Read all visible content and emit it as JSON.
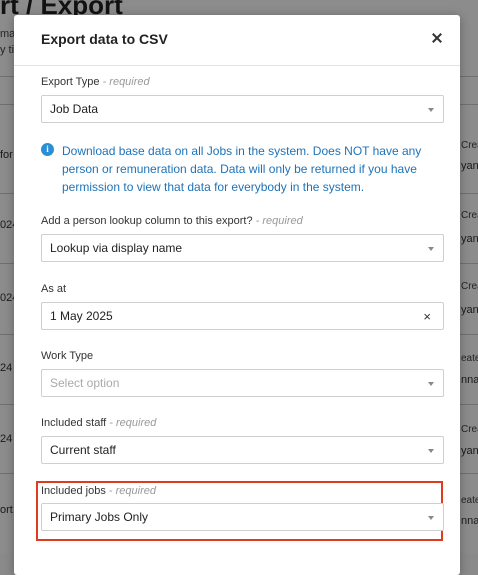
{
  "background": {
    "title": "rt / Export",
    "subtitle_lines": [
      "make",
      "y time"
    ],
    "rows_left": [
      "for 26",
      "024 2",
      "024 1",
      "24 12",
      "24 10",
      "ort fo"
    ],
    "rows_right_a": [
      "Crea",
      "Crea",
      "Crea",
      "eate",
      "Crea",
      "eate"
    ],
    "rows_right_b": [
      "yan",
      "yan",
      "yan",
      "nna",
      "yan",
      "nna"
    ]
  },
  "modal": {
    "title": "Export data to CSV",
    "close_icon": "close-icon",
    "export_type": {
      "label": "Export Type",
      "required": "- required",
      "value": "Job Data"
    },
    "info": {
      "icon": "info-icon",
      "icon_glyph": "i",
      "text": "Download base data on all Jobs in the system. Does NOT have any person or remuneration data. Data will only be returned if you have permission to view that data for everybody in the system."
    },
    "lookup": {
      "label": "Add a person lookup column to this export?",
      "required": "- required",
      "value": "Lookup via display name"
    },
    "as_at": {
      "label": "As at",
      "value": "1 May 2025",
      "clear": "×"
    },
    "work_type": {
      "label": "Work Type",
      "placeholder": "Select option"
    },
    "included_staff": {
      "label": "Included staff",
      "required": "- required",
      "value": "Current staff"
    },
    "included_jobs": {
      "label": "Included jobs",
      "required": "- required",
      "value": "Primary Jobs Only"
    }
  },
  "colors": {
    "info_text": "#1e73b8",
    "highlight": "#e03a1f"
  }
}
